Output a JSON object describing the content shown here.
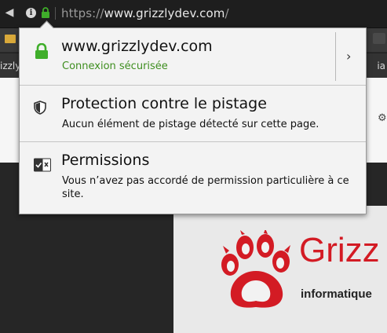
{
  "browser": {
    "url_scheme": "https://",
    "url_host": "www.grizzlydev.com",
    "url_path": "/",
    "tab_left_fragment": "izzly",
    "tab_right_fragment": "ia"
  },
  "popup": {
    "site": {
      "title": "www.grizzlydev.com",
      "status": "Connexion sécurisée",
      "status_color": "#3e8e1f"
    },
    "tracking": {
      "title": "Protection contre le pistage",
      "description": "Aucun élément de pistage détecté sur cette page."
    },
    "permissions": {
      "title": "Permissions",
      "description": "Vous n’avez pas accordé de permission particulière à ce site."
    }
  },
  "page": {
    "logo_text": "Grizz",
    "logo_subtitle": "informatique",
    "brand_color": "#d31b24"
  },
  "icons": {
    "back": "back-arrow-icon",
    "info": "info-icon",
    "lock": "lock-icon",
    "shield": "shield-icon",
    "permissions": "permissions-icon",
    "chevron": "chevron-right-icon"
  }
}
